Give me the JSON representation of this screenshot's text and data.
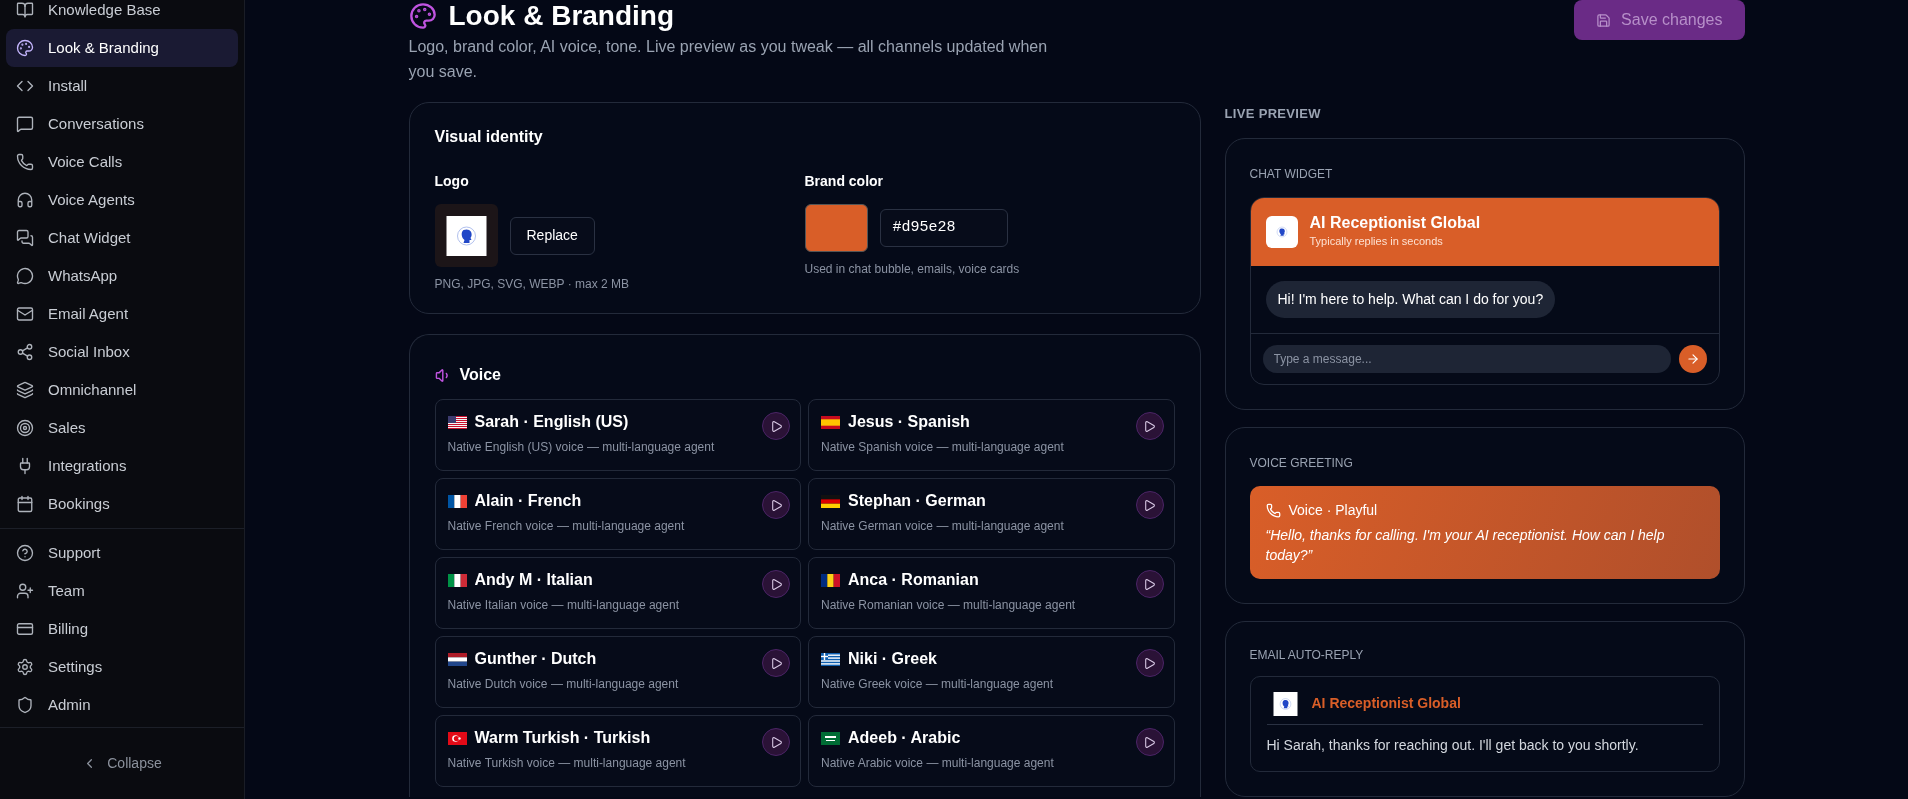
{
  "sidebar": {
    "items": [
      {
        "label": "Knowledge Base",
        "selected": false
      },
      {
        "label": "Look & Branding",
        "selected": true
      },
      {
        "label": "Install",
        "selected": false
      },
      {
        "label": "Conversations",
        "selected": false
      },
      {
        "label": "Voice Calls",
        "selected": false
      },
      {
        "label": "Voice Agents",
        "selected": false
      },
      {
        "label": "Chat Widget",
        "selected": false
      },
      {
        "label": "WhatsApp",
        "selected": false
      },
      {
        "label": "Email Agent",
        "selected": false
      },
      {
        "label": "Social Inbox",
        "selected": false
      },
      {
        "label": "Omnichannel",
        "selected": false
      },
      {
        "label": "Sales",
        "selected": false
      },
      {
        "label": "Integrations",
        "selected": false
      },
      {
        "label": "Bookings",
        "selected": false
      }
    ],
    "footer_items": [
      {
        "label": "Support",
        "selected": false
      },
      {
        "label": "Team",
        "selected": false
      },
      {
        "label": "Billing",
        "selected": false
      },
      {
        "label": "Settings",
        "selected": false
      },
      {
        "label": "Admin",
        "selected": false
      }
    ],
    "collapse": "Collapse"
  },
  "header": {
    "title": "Look & Branding",
    "subtitle": "Logo, brand color, AI voice, tone. Live preview as you tweak — all channels updated when you save.",
    "save_button": {
      "label": "Save changes",
      "disabled": true
    }
  },
  "visual_identity": {
    "title": "Visual identity",
    "logo": {
      "label": "Logo",
      "replace_button": "Replace",
      "hint": "PNG, JPG, SVG, WEBP · max 2 MB"
    },
    "brand_color": {
      "label": "Brand color",
      "value": "#d95e28",
      "hint": "Used in chat bubble, emails, voice cards"
    }
  },
  "voice": {
    "title": "Voice",
    "voices": [
      {
        "name": "Sarah · English (US)",
        "description": "Native English (US) voice — multi-language agent"
      },
      {
        "name": "Jesus · Spanish",
        "description": "Native Spanish voice — multi-language agent"
      },
      {
        "name": "Alain · French",
        "description": "Native French voice — multi-language agent"
      },
      {
        "name": "Stephan · German",
        "description": "Native German voice — multi-language agent"
      },
      {
        "name": "Andy M · Italian",
        "description": "Native Italian voice — multi-language agent"
      },
      {
        "name": "Anca · Romanian",
        "description": "Native Romanian voice — multi-language agent"
      },
      {
        "name": "Gunther · Dutch",
        "description": "Native Dutch voice — multi-language agent"
      },
      {
        "name": "Niki · Greek",
        "description": "Native Greek voice — multi-language agent"
      },
      {
        "name": "Warm Turkish · Turkish",
        "description": "Native Turkish voice — multi-language agent"
      },
      {
        "name": "Adeeb · Arabic",
        "description": "Native Arabic voice — multi-language agent"
      }
    ]
  },
  "preview": {
    "title": "LIVE PREVIEW",
    "chat_widget": {
      "title": "CHAT WIDGET",
      "name": "AI Receptionist Global",
      "status": "Typically replies in seconds",
      "message": "Hi! I'm here to help. What can I do for you?",
      "input_placeholder": "Type a message..."
    },
    "voice_greeting": {
      "title": "VOICE GREETING",
      "label": "Voice · Playful",
      "quote": "“Hello, thanks for calling. I'm your AI receptionist. How can I help today?”"
    },
    "email": {
      "title": "EMAIL AUTO-REPLY",
      "sender": "AI Receptionist Global",
      "body": "Hi Sarah, thanks for reaching out. I'll get back to you shortly."
    }
  }
}
